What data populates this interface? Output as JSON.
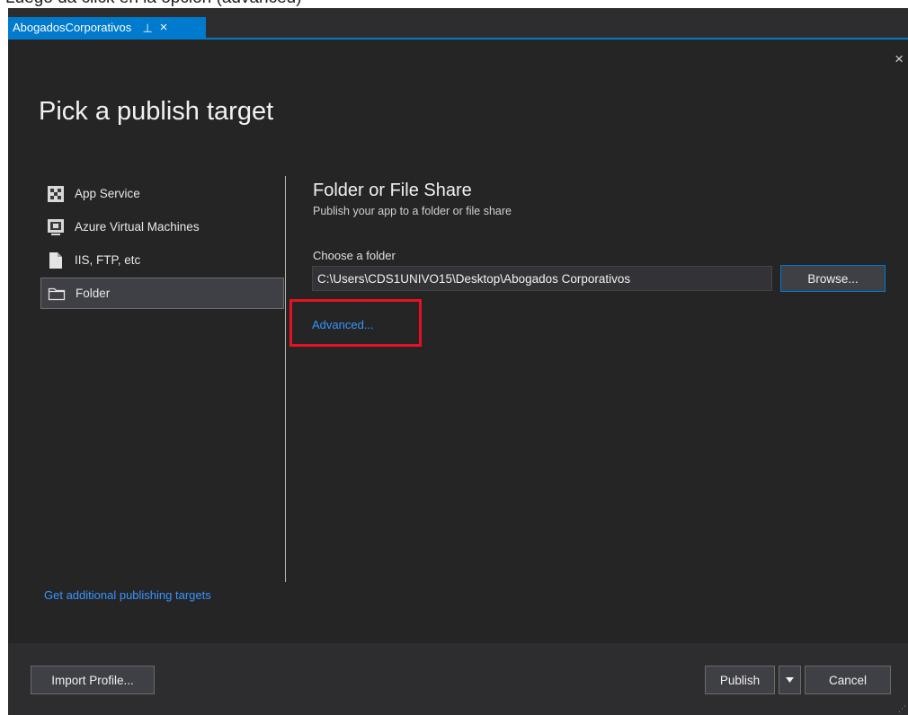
{
  "caption": "Luego da click en la opción (advanced)",
  "tab": {
    "title": "AbogadosCorporativos",
    "pin_icon": "pin-icon",
    "close_icon": "close-icon"
  },
  "dialog": {
    "title": "Pick a publish target",
    "close_glyph": "×",
    "targets": [
      {
        "label": "App Service",
        "icon": "app-service-icon",
        "selected": false
      },
      {
        "label": "Azure Virtual Machines",
        "icon": "virtual-machine-icon",
        "selected": false
      },
      {
        "label": "IIS, FTP, etc",
        "icon": "document-icon",
        "selected": false
      },
      {
        "label": "Folder",
        "icon": "folder-icon",
        "selected": true
      }
    ],
    "more_targets_link": "Get additional publishing targets",
    "detail": {
      "heading": "Folder or File Share",
      "description": "Publish your app to a folder or file share",
      "folder_label": "Choose a folder",
      "folder_value": "C:\\Users\\CDS1UNIVO15\\Desktop\\Abogados Corporativos",
      "browse_label": "Browse...",
      "advanced_link": "Advanced..."
    },
    "highlight_color": "#e81123",
    "footer": {
      "import_label": "Import Profile...",
      "publish_label": "Publish",
      "cancel_label": "Cancel"
    }
  },
  "colors": {
    "accent": "#007acc",
    "link": "#3794ff",
    "background": "#252526"
  }
}
